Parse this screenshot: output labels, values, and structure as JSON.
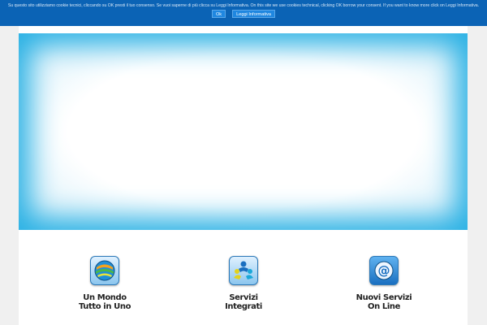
{
  "cookie_bar": {
    "message": "Su questo sito utilizziamo cookie tecnici, cliccando su OK presti il tuo consenso. Se vuoi saperne di più clicca su Leggi Informativa. On this site we use cookies technical, clicking OK borrow your consent. If you want to know more click on Leggi Informativa.",
    "ok_label": "Ok",
    "info_label": "Leggi Informativa"
  },
  "features": [
    {
      "icon": "globe-icon",
      "title_line1": "Un Mondo",
      "title_line2": "Tutto in Uno"
    },
    {
      "icon": "people-icon",
      "title_line1": "Servizi",
      "title_line2": "Integrati"
    },
    {
      "icon": "at-sign-icon",
      "title_line1": "Nuovi Servizi",
      "title_line2": "On Line"
    }
  ],
  "colors": {
    "cookie_bar_bg": "#0b63b5",
    "hero_glow": "#2ab1e4",
    "page_bg": "#f0f0f0"
  }
}
